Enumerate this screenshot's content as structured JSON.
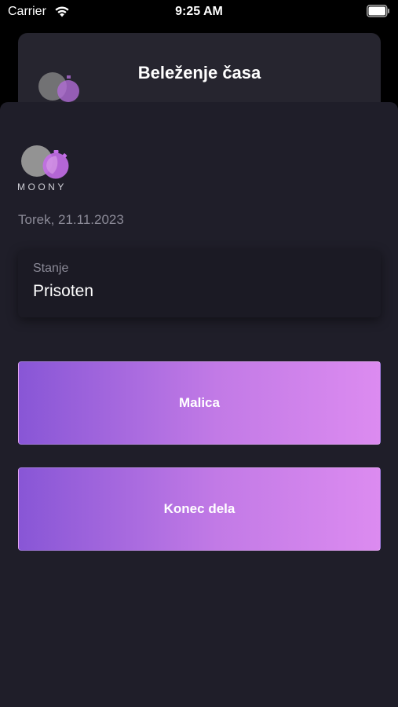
{
  "status_bar": {
    "carrier": "Carrier",
    "time": "9:25 AM",
    "wifi_icon": "wifi-icon",
    "battery_icon": "battery-icon"
  },
  "back_sheet": {
    "title": "Beleženje časa",
    "logo_icon": "moony-logo-icon"
  },
  "sheet": {
    "logo_text": "MOONY",
    "logo_icon": "moony-logo-icon",
    "date": "Torek, 21.11.2023",
    "status_card": {
      "label": "Stanje",
      "value": "Prisoten"
    },
    "buttons": {
      "malica": "Malica",
      "konec_dela": "Konec dela"
    }
  },
  "colors": {
    "background": "#1f1e29",
    "card": "#1b1a24",
    "accent_start": "#8856d6",
    "accent_end": "#dc8bf0",
    "muted_text": "#8b8a97"
  }
}
